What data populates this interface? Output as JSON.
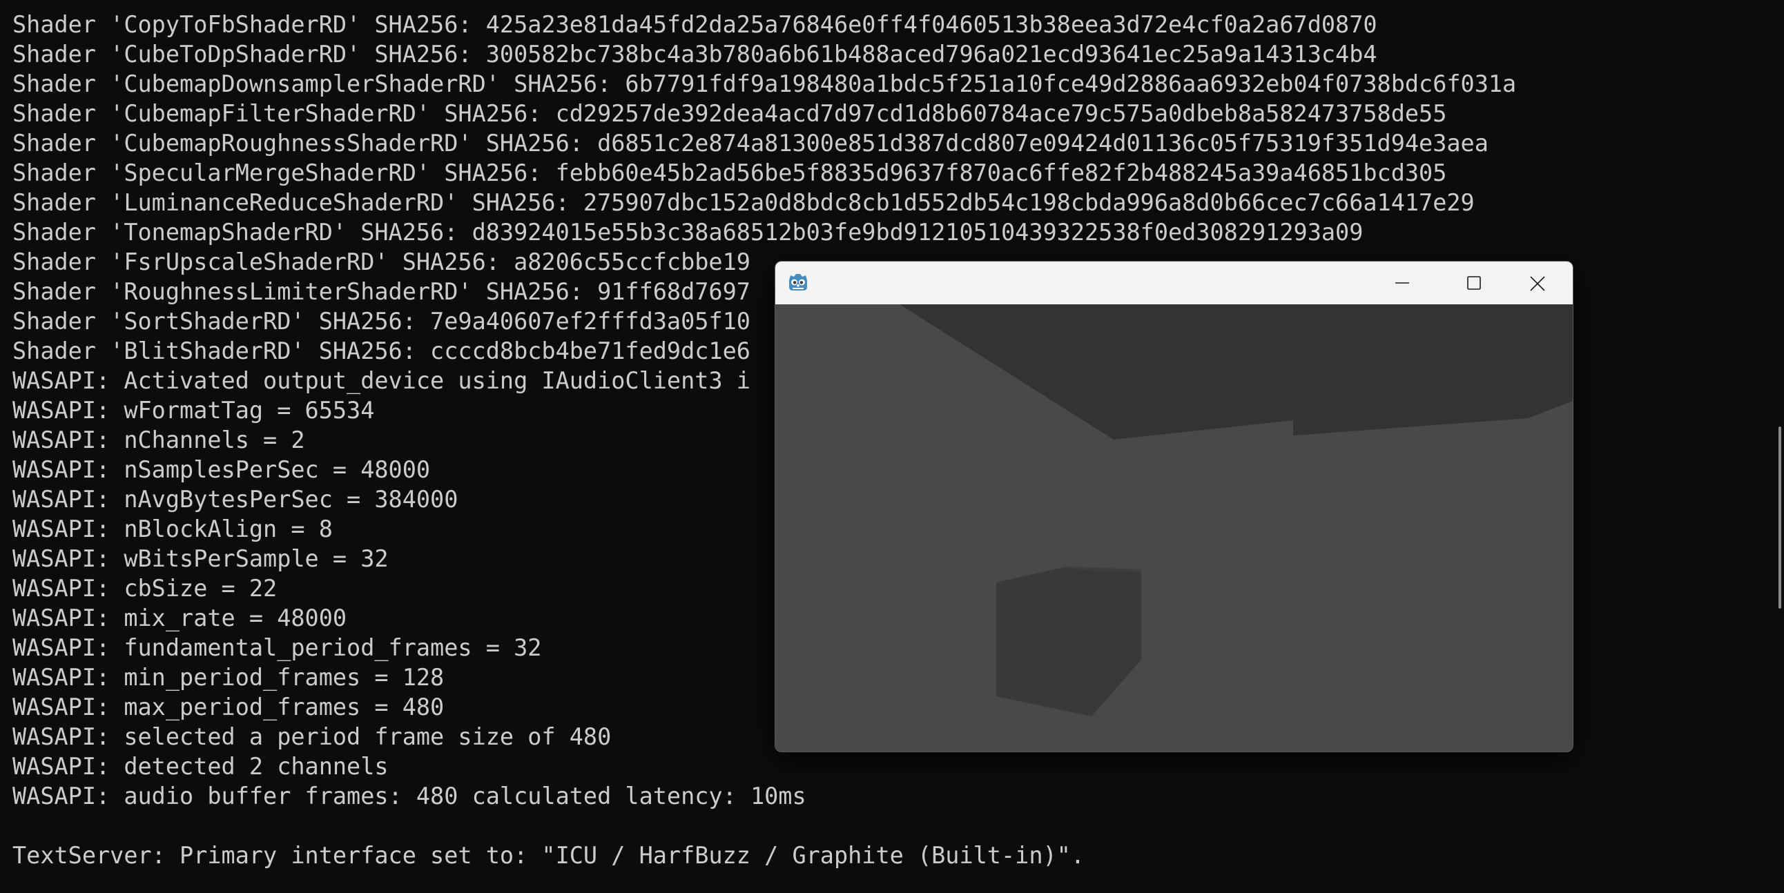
{
  "console": {
    "lines": [
      "Shader 'CopyToFbShaderRD' SHA256: 425a23e81da45fd2da25a76846e0ff4f0460513b38eea3d72e4cf0a2a67d0870",
      "Shader 'CubeToDpShaderRD' SHA256: 300582bc738bc4a3b780a6b61b488aced796a021ecd93641ec25a9a14313c4b4",
      "Shader 'CubemapDownsamplerShaderRD' SHA256: 6b7791fdf9a198480a1bdc5f251a10fce49d2886aa6932eb04f0738bdc6f031a",
      "Shader 'CubemapFilterShaderRD' SHA256: cd29257de392dea4acd7d97cd1d8b60784ace79c575a0dbeb8a582473758de55",
      "Shader 'CubemapRoughnessShaderRD' SHA256: d6851c2e874a81300e851d387dcd807e09424d01136c05f75319f351d94e3aea",
      "Shader 'SpecularMergeShaderRD' SHA256: febb60e45b2ad56be5f8835d9637f870ac6ffe82f2b488245a39a46851bcd305",
      "Shader 'LuminanceReduceShaderRD' SHA256: 275907dbc152a0d8bdc8cb1d552db54c198cbda996a8d0b66cec7c66a1417e29",
      "Shader 'TonemapShaderRD' SHA256: d83924015e55b3c38a68512b03fe9bd91210510439322538f0ed308291293a09",
      "Shader 'FsrUpscaleShaderRD' SHA256: a8206c55ccfcbbe19",
      "Shader 'RoughnessLimiterShaderRD' SHA256: 91ff68d7697",
      "Shader 'SortShaderRD' SHA256: 7e9a40607ef2fffd3a05f10",
      "Shader 'BlitShaderRD' SHA256: ccccd8bcb4be71fed9dc1e6",
      "WASAPI: Activated output_device using IAudioClient3 i",
      "WASAPI: wFormatTag = 65534",
      "WASAPI: nChannels = 2",
      "WASAPI: nSamplesPerSec = 48000",
      "WASAPI: nAvgBytesPerSec = 384000",
      "WASAPI: nBlockAlign = 8",
      "WASAPI: wBitsPerSample = 32",
      "WASAPI: cbSize = 22",
      "WASAPI: mix_rate = 48000",
      "WASAPI: fundamental_period_frames = 32",
      "WASAPI: min_period_frames = 128",
      "WASAPI: max_period_frames = 480",
      "WASAPI: selected a period frame size of 480",
      "WASAPI: detected 2 channels",
      "WASAPI: audio buffer frames: 480 calculated latency: 10ms",
      "",
      "TextServer: Primary interface set to: \"ICU / HarfBuzz / Graphite (Built-in)\"."
    ]
  },
  "game_window": {
    "app_icon": "godot-engine-icon",
    "buttons": {
      "minimize_icon": "minimize-icon",
      "maximize_icon": "maximize-icon",
      "close_icon": "close-icon"
    },
    "colors": {
      "titlebar": "#f3f3f3",
      "background": "#484848",
      "ceiling": "#333333",
      "cube": "#393939",
      "godot_blue": "#478cbf"
    }
  }
}
